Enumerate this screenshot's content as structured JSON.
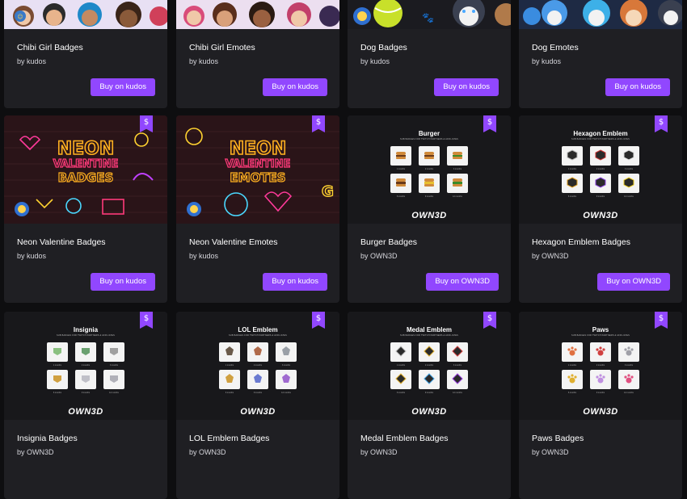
{
  "accent_color": "#9147ff",
  "price_icon": "dollar-sign",
  "products": [
    {
      "title": "Chibi Girl Badges",
      "by": "by kudos",
      "buy": "Buy on kudos",
      "thumb": "chibi-girl-badges-preview"
    },
    {
      "title": "Chibi Girl Emotes",
      "by": "by kudos",
      "buy": "Buy on kudos",
      "thumb": "chibi-girl-emotes-preview"
    },
    {
      "title": "Dog Badges",
      "by": "by kudos",
      "buy": "Buy on kudos",
      "thumb": "dog-badges-preview"
    },
    {
      "title": "Dog Emotes",
      "by": "by kudos",
      "buy": "Buy on kudos",
      "thumb": "dog-emotes-preview"
    },
    {
      "title": "Neon Valentine Badges",
      "by": "by kudos",
      "buy": "Buy on kudos",
      "thumb_text": [
        "NEON",
        "VALENTINE",
        "BADGES"
      ]
    },
    {
      "title": "Neon Valentine Emotes",
      "by": "by kudos",
      "buy": "Buy on kudos",
      "thumb_text": [
        "NEON",
        "VALENTINE",
        "EMOTES"
      ]
    },
    {
      "title": "Burger Badges",
      "by": "by OWN3D",
      "buy": "Buy on OWN3D",
      "sheet_title": "Burger",
      "sheet_sub": "SUB BADGES FOR TWITCH PARTNERS & AFFILIATES",
      "tile_labels": [
        "1 months",
        "2 months",
        "3 months",
        "6 months",
        "9 months",
        "12 months"
      ],
      "logo": "OWN3D"
    },
    {
      "title": "Hexagon Emblem Badges",
      "by": "by OWN3D",
      "buy": "Buy on OWN3D",
      "sheet_title": "Hexagon Emblem",
      "sheet_sub": "SUB BADGES FOR TWITCH PARTNERS & AFFILIATES",
      "tile_labels": [
        "1 months",
        "2 months",
        "3 months",
        "6 months",
        "9 months",
        "12 months"
      ],
      "logo": "OWN3D"
    },
    {
      "title": "Insignia Badges",
      "by": "by OWN3D",
      "sheet_title": "Insignia",
      "sheet_sub": "SUB BADGES FOR TWITCH PARTNERS & AFFILIATES",
      "tile_labels": [
        "1 months",
        "2 months",
        "3 months",
        "6 months",
        "9 months",
        "12 months"
      ],
      "logo": "OWN3D"
    },
    {
      "title": "LOL Emblem Badges",
      "by": "by OWN3D",
      "sheet_title": "LOL Emblem",
      "sheet_sub": "SUB BADGES FOR TWITCH PARTNERS & AFFILIATES",
      "tile_labels": [
        "1 months",
        "2 months",
        "3 months",
        "6 months",
        "9 months",
        "12 months"
      ],
      "logo": "OWN3D"
    },
    {
      "title": "Medal Emblem Badges",
      "by": "by OWN3D",
      "sheet_title": "Medal Emblem",
      "sheet_sub": "SUB BADGES FOR TWITCH PARTNERS & AFFILIATES",
      "tile_labels": [
        "1 months",
        "2 months",
        "3 months",
        "6 months",
        "9 months",
        "12 months"
      ],
      "logo": "OWN3D"
    },
    {
      "title": "Paws Badges",
      "by": "by OWN3D",
      "sheet_title": "Paws",
      "sheet_sub": "SUB BADGES FOR TWITCH PARTNERS & AFFILIATES",
      "tile_labels": [
        "1 months",
        "2 months",
        "3 months",
        "6 months",
        "9 months",
        "12 months"
      ],
      "logo": "OWN3D"
    }
  ]
}
